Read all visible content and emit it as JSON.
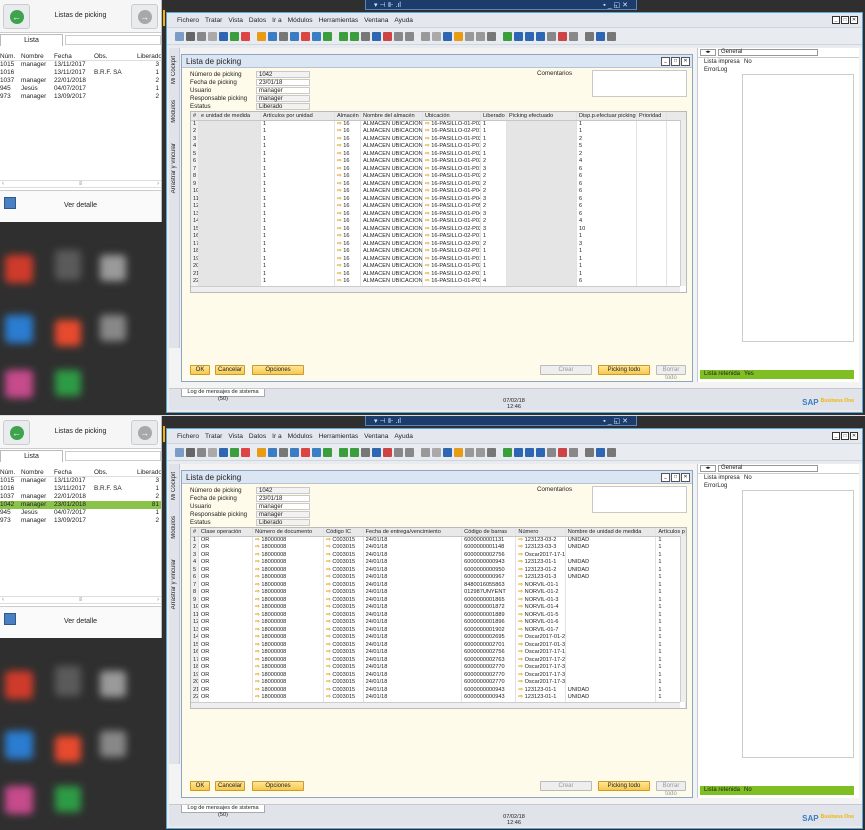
{
  "shots": [
    {
      "panel": {
        "title": "Listas de picking",
        "tab": "Lista",
        "detail": "Ver detalle",
        "columns": [
          "Núm.",
          "Nombre",
          "Fecha",
          "Obs.",
          "Liberado"
        ],
        "rows": [
          [
            "1015",
            "manager",
            "13/11/2017",
            "",
            "3"
          ],
          [
            "1016",
            "",
            "13/11/2017",
            "B.R.F. SA",
            "1"
          ],
          [
            "1037",
            "manager",
            "22/01/2018",
            "",
            "2"
          ],
          [
            "945",
            "Jesús",
            "04/07/2017",
            "",
            "1"
          ],
          [
            "973",
            "manager",
            "13/09/2017",
            "",
            "2"
          ]
        ]
      },
      "menu": [
        "Fichero",
        "Tratar",
        "Vista",
        "Datos",
        "Ir a",
        "Módulos",
        "Herramientas",
        "Ventana",
        "Ayuda"
      ],
      "sidetabs": [
        "Mi Cockpit",
        "Módulos",
        "Arrastrar y vincular"
      ],
      "window_title": "Lista de picking",
      "header": [
        [
          "Número de picking",
          "1042"
        ],
        [
          "Fecha de picking",
          "23/01/18"
        ],
        [
          "Usuario",
          "manager"
        ],
        [
          "Responsable picking",
          "manager"
        ],
        [
          "Estatus",
          "Liberado"
        ]
      ],
      "comments_label": "Comentarios",
      "grid_columns": [
        "#",
        "e unidad de medida",
        "Artículos por unidad",
        "Almacén",
        "Nombre del almacén",
        "Ubicación",
        "Liberado",
        "Picking efectuado",
        "Disp.p.efectuar picking",
        "Prioridad"
      ],
      "grid_rows": [
        [
          "1",
          "",
          "1",
          "16",
          "ALMACEN UBICACIONES",
          "16-PASILLO-01-P02",
          "1",
          "",
          "1",
          ""
        ],
        [
          "2",
          "",
          "1",
          "16",
          "ALMACEN UBICACIONES",
          "16-PASILLO-02-P01",
          "1",
          "",
          "1",
          ""
        ],
        [
          "3",
          "",
          "1",
          "16",
          "ALMACEN UBICACIONES",
          "16-PASILLO-01-P02",
          "1",
          "",
          "2",
          ""
        ],
        [
          "4",
          "",
          "1",
          "16",
          "ALMACEN UBICACIONES",
          "16-PASILLO-01-P01",
          "2",
          "",
          "5",
          ""
        ],
        [
          "5",
          "",
          "1",
          "16",
          "ALMACEN UBICACIONES",
          "16-PASILLO-01-P02",
          "1",
          "",
          "2",
          ""
        ],
        [
          "6",
          "",
          "1",
          "16",
          "ALMACEN UBICACIONES",
          "16-PASILLO-01-P03",
          "2",
          "",
          "4",
          ""
        ],
        [
          "7",
          "",
          "1",
          "16",
          "ALMACEN UBICACIONES",
          "16-PASILLO-01-P01",
          "3",
          "",
          "6",
          ""
        ],
        [
          "8",
          "",
          "1",
          "16",
          "ALMACEN UBICACIONES",
          "16-PASILLO-01-P02",
          "2",
          "",
          "6",
          ""
        ],
        [
          "9",
          "",
          "1",
          "16",
          "ALMACEN UBICACIONES",
          "16-PASILLO-01-P03",
          "2",
          "",
          "6",
          ""
        ],
        [
          "10",
          "",
          "1",
          "16",
          "ALMACEN UBICACIONES",
          "16-PASILLO-01-P04-1",
          "2",
          "",
          "6",
          ""
        ],
        [
          "11",
          "",
          "1",
          "16",
          "ALMACEN UBICACIONES",
          "16-PASILLO-01-P04-1",
          "3",
          "",
          "6",
          ""
        ],
        [
          "12",
          "",
          "1",
          "16",
          "ALMACEN UBICACIONES",
          "16-PASILLO-01-P05-1",
          "2",
          "",
          "6",
          ""
        ],
        [
          "13",
          "",
          "1",
          "16",
          "ALMACEN UBICACIONES",
          "16-PASILLO-01-P04-1",
          "3",
          "",
          "6",
          ""
        ],
        [
          "14",
          "",
          "1",
          "16",
          "ALMACEN UBICACIONES",
          "16-PASILLO-01-P03",
          "2",
          "",
          "4",
          ""
        ],
        [
          "15",
          "",
          "1",
          "16",
          "ALMACEN UBICACIONES",
          "16-PASILLO-02-P02",
          "3",
          "",
          "10",
          ""
        ],
        [
          "16",
          "",
          "1",
          "16",
          "ALMACEN UBICACIONES",
          "16-PASILLO-02-P01",
          "1",
          "",
          "1",
          ""
        ],
        [
          "17",
          "",
          "1",
          "16",
          "ALMACEN UBICACIONES",
          "16-PASILLO-02-P01",
          "2",
          "",
          "3",
          ""
        ],
        [
          "18",
          "",
          "1",
          "16",
          "ALMACEN UBICACIONES",
          "16-PASILLO-02-P01",
          "1",
          "",
          "1",
          ""
        ],
        [
          "19",
          "",
          "1",
          "16",
          "ALMACEN UBICACIONES",
          "16-PASILLO-01-P01",
          "1",
          "",
          "1",
          ""
        ],
        [
          "20",
          "",
          "1",
          "16",
          "ALMACEN UBICACIONES",
          "16-PASILLO-01-P03",
          "1",
          "",
          "1",
          ""
        ],
        [
          "21",
          "",
          "1",
          "16",
          "ALMACEN UBICACIONES",
          "16-PASILLO-02-P01",
          "1",
          "",
          "1",
          ""
        ],
        [
          "22",
          "",
          "1",
          "16",
          "ALMACEN UBICACIONES",
          "16-PASILLO-01-P02",
          "4",
          "",
          "6",
          ""
        ],
        [
          "23",
          "",
          "1",
          "16",
          "ALMACEN UBICACIONES",
          "16-PASILLO-02-P01",
          "1",
          "",
          "5",
          ""
        ],
        [
          "24",
          "",
          "1",
          "16",
          "ALMACEN UBICACIONES",
          "16-PASILLO-01-P01",
          "2",
          "",
          "2",
          ""
        ]
      ],
      "buttons": {
        "ok": "OK",
        "cancel": "Cancelar",
        "options": "Opciones",
        "create": "Crear",
        "picking_all": "Picking todo",
        "clear_all": "Borrar todo"
      },
      "right": {
        "select": "General",
        "rows": [
          [
            "Lista impresa",
            "No"
          ],
          [
            "ErrorLog",
            ""
          ]
        ],
        "retenida": [
          "Lista retenida",
          "Yes"
        ]
      },
      "status": {
        "log": "Log de mensajes de sistema (50)",
        "date": "07/02/18",
        "time": "12:46"
      }
    },
    {
      "panel": {
        "title": "Listas de picking",
        "tab": "Lista",
        "detail": "Ver detalle",
        "columns": [
          "Núm.",
          "Nombre",
          "Fecha",
          "Obs.",
          "Liberado"
        ],
        "rows": [
          [
            "1015",
            "manager",
            "13/11/2017",
            "",
            "3"
          ],
          [
            "1016",
            "",
            "13/11/2017",
            "B.R.F. SA",
            "1"
          ],
          [
            "1037",
            "manager",
            "22/01/2018",
            "",
            "2"
          ],
          [
            "1042",
            "manager",
            "23/01/2018",
            "",
            "81"
          ],
          [
            "945",
            "Jesús",
            "04/07/2017",
            "",
            "1"
          ],
          [
            "973",
            "manager",
            "13/09/2017",
            "",
            "2"
          ]
        ]
      },
      "menu": [
        "Fichero",
        "Tratar",
        "Vista",
        "Datos",
        "Ir a",
        "Módulos",
        "Herramientas",
        "Ventana",
        "Ayuda"
      ],
      "sidetabs": [
        "Mi Cockpit",
        "Módulos",
        "Arrastrar y vincular"
      ],
      "window_title": "Lista de picking",
      "header": [
        [
          "Número de picking",
          "1042"
        ],
        [
          "Fecha de picking",
          "23/01/18"
        ],
        [
          "Usuario",
          "manager"
        ],
        [
          "Responsable picking",
          "manager"
        ],
        [
          "Estatus",
          "Liberado"
        ]
      ],
      "comments_label": "Comentarios",
      "grid_columns": [
        "#",
        "Clase operación",
        "Número de documento",
        "Código IC",
        "Fecha de entrega/vencimiento",
        "Código de barras",
        "Número",
        "Nombre de unidad de medida",
        "Artículos p..."
      ],
      "grid_rows": [
        [
          "1",
          "OR",
          "18000008",
          "C003015",
          "24/01/18",
          "6000000001131",
          "123123-03-2",
          "UNIDAD",
          "1"
        ],
        [
          "2",
          "OR",
          "18000008",
          "C003015",
          "24/01/18",
          "6000000001148",
          "123123-03-3",
          "UNIDAD",
          "1"
        ],
        [
          "3",
          "OR",
          "18000008",
          "C003015",
          "24/01/18",
          "6000000002756",
          "Oscar2017-17-1",
          "",
          "1"
        ],
        [
          "4",
          "OR",
          "18000008",
          "C003015",
          "24/01/18",
          "6000000000943",
          "123123-01-1",
          "UNIDAD",
          "1"
        ],
        [
          "5",
          "OR",
          "18000008",
          "C003015",
          "24/01/18",
          "6000000000950",
          "123123-01-2",
          "UNIDAD",
          "1"
        ],
        [
          "6",
          "OR",
          "18000008",
          "C003015",
          "24/01/18",
          "6000000000967",
          "123123-01-3",
          "UNIDAD",
          "1"
        ],
        [
          "7",
          "OR",
          "18000008",
          "C003015",
          "24/01/18",
          "8480016055863",
          "NORVIL-01-1",
          "",
          "1"
        ],
        [
          "8",
          "OR",
          "18000008",
          "C003015",
          "24/01/18",
          "012987UNYENT",
          "NORVIL-01-2",
          "",
          "1"
        ],
        [
          "9",
          "OR",
          "18000008",
          "C003015",
          "24/01/18",
          "6000000001865",
          "NORVIL-01-3",
          "",
          "1"
        ],
        [
          "10",
          "OR",
          "18000008",
          "C003015",
          "24/01/18",
          "6000000001872",
          "NORVIL-01-4",
          "",
          "1"
        ],
        [
          "11",
          "OR",
          "18000008",
          "C003015",
          "24/01/18",
          "6000000001889",
          "NORVIL-01-5",
          "",
          "1"
        ],
        [
          "12",
          "OR",
          "18000008",
          "C003015",
          "24/01/18",
          "6000000001896",
          "NORVIL-01-6",
          "",
          "1"
        ],
        [
          "13",
          "OR",
          "18000008",
          "C003015",
          "24/01/18",
          "6000000001902",
          "NORVIL-01-7",
          "",
          "1"
        ],
        [
          "14",
          "OR",
          "18000008",
          "C003015",
          "24/01/18",
          "6000000002695",
          "Oscar2017-01-2",
          "",
          "1"
        ],
        [
          "15",
          "OR",
          "18000008",
          "C003015",
          "24/01/18",
          "6000000002701",
          "Oscar2017-01-3",
          "",
          "1"
        ],
        [
          "16",
          "OR",
          "18000008",
          "C003015",
          "24/01/18",
          "6000000002756",
          "Oscar2017-17-1",
          "",
          "1"
        ],
        [
          "17",
          "OR",
          "18000008",
          "C003015",
          "24/01/18",
          "6000000002763",
          "Oscar2017-17-2",
          "",
          "1"
        ],
        [
          "18",
          "OR",
          "18000008",
          "C003015",
          "24/01/18",
          "6000000002770",
          "Oscar2017-17-3",
          "",
          "1"
        ],
        [
          "19",
          "OR",
          "18000008",
          "C003015",
          "24/01/18",
          "6000000002770",
          "Oscar2017-17-3",
          "",
          "1"
        ],
        [
          "20",
          "OR",
          "18000008",
          "C003015",
          "24/01/18",
          "6000000002770",
          "Oscar2017-17-3",
          "",
          "1"
        ],
        [
          "21",
          "OR",
          "18000008",
          "C003015",
          "24/01/18",
          "6000000000943",
          "123123-01-1",
          "UNIDAD",
          "1"
        ],
        [
          "22",
          "OR",
          "18000008",
          "C003015",
          "24/01/18",
          "6000000000943",
          "123123-01-1",
          "UNIDAD",
          "1"
        ],
        [
          "23",
          "OR",
          "18000008",
          "C003015",
          "24/01/18",
          "6000000000950",
          "123123-01-2",
          "UNIDAD",
          "1"
        ]
      ],
      "buttons": {
        "ok": "OK",
        "cancel": "Cancelar",
        "options": "Opciones",
        "create": "Crear",
        "picking_all": "Picking todo",
        "clear_all": "Borrar todo"
      },
      "right": {
        "select": "General",
        "rows": [
          [
            "Lista impresa",
            "No"
          ],
          [
            "ErrorLog",
            ""
          ]
        ],
        "retenida": [
          "Lista retenida",
          "No"
        ]
      },
      "status": {
        "log": "Log de mensajes de sistema (50)",
        "date": "07/02/18",
        "time": "12:46"
      }
    }
  ],
  "selected_panel_row": {
    "shot": 1,
    "row": 3
  },
  "colors": {
    "accent_green": "#7ec023",
    "sap_blue": "#3b7dc4",
    "button_yellow": "#f8c94b"
  },
  "icons": [
    "back-arrow-icon",
    "forward-arrow-icon",
    "detail-icon",
    "link-arrow-icon",
    "calendar-icon",
    "sap-logo"
  ]
}
